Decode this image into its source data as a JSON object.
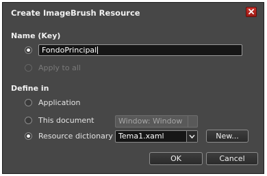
{
  "dialog": {
    "title": "Create ImageBrush Resource",
    "close_icon": "close-x-icon",
    "accent_close": "#b52a24"
  },
  "name_section": {
    "heading": "Name (Key)",
    "key_value": "FondoPrincipal",
    "apply_to_all_label": "Apply to all",
    "key_selected": true,
    "apply_to_all_selected": false
  },
  "define_section": {
    "heading": "Define in",
    "options": [
      {
        "label": "Application",
        "selected": false
      },
      {
        "label": "This document",
        "selected": false
      },
      {
        "label": "Resource dictionary",
        "selected": true
      }
    ],
    "document_combo_value": "Window: Window",
    "dictionary_combo_value": "Tema1.xaml",
    "new_button_label": "New..."
  },
  "footer": {
    "ok_label": "OK",
    "cancel_label": "Cancel"
  }
}
